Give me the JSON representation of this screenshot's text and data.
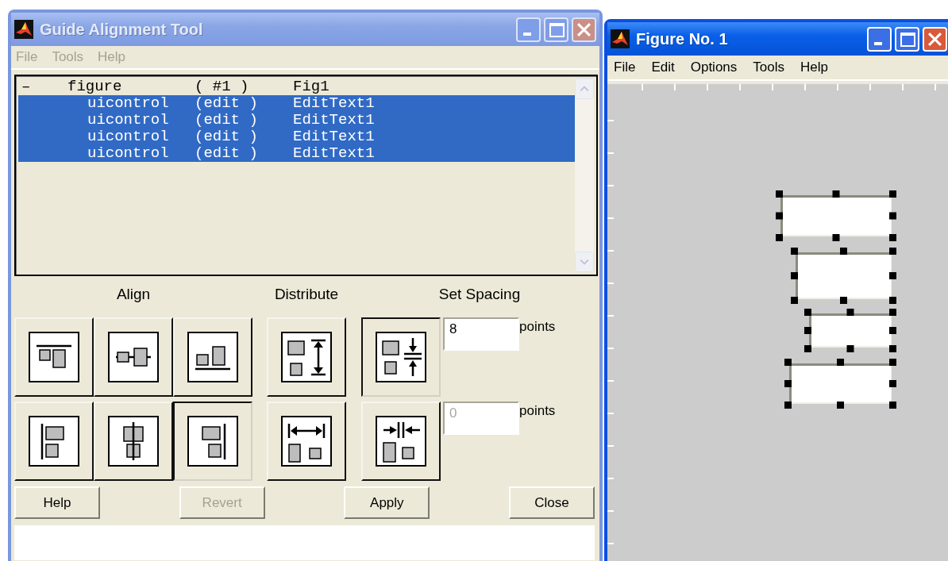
{
  "tool_window": {
    "title": "Guide Alignment Tool",
    "active": false,
    "menu": [
      {
        "label": "File",
        "disabled": true
      },
      {
        "label": "Tools",
        "disabled": true
      },
      {
        "label": "Help",
        "disabled": true
      }
    ],
    "object_list": {
      "rows": [
        {
          "toggle": "–",
          "type": "figure",
          "tag": "( #1 )",
          "name": "Fig1",
          "selected": false,
          "children": [
            {
              "type": "uicontrol",
              "tag": "(edit )",
              "name": "EditText1",
              "selected": true
            },
            {
              "type": "uicontrol",
              "tag": "(edit )",
              "name": "EditText1",
              "selected": true
            },
            {
              "type": "uicontrol",
              "tag": "(edit )",
              "name": "EditText1",
              "selected": true
            },
            {
              "type": "uicontrol",
              "tag": "(edit )",
              "name": "EditText1",
              "selected": true
            }
          ]
        }
      ]
    },
    "align": {
      "heading": "Align",
      "buttons": [
        {
          "kind": "top",
          "pressed": false
        },
        {
          "kind": "vcenter",
          "pressed": false
        },
        {
          "kind": "bottom",
          "pressed": false
        },
        {
          "kind": "left",
          "pressed": false
        },
        {
          "kind": "hcenter",
          "pressed": false
        },
        {
          "kind": "right",
          "pressed": true
        }
      ]
    },
    "distribute": {
      "heading": "Distribute",
      "buttons": [
        {
          "kind": "dist-vertical",
          "pressed": false
        },
        {
          "kind": "dist-horizontal",
          "pressed": false
        }
      ]
    },
    "spacing": {
      "heading": "Set Spacing",
      "rows": [
        {
          "kind": "space-vertical",
          "pressed": true,
          "value": "8",
          "disabled": false,
          "unit": "points"
        },
        {
          "kind": "space-horizontal",
          "pressed": false,
          "value": "0",
          "disabled": true,
          "unit": "points"
        }
      ]
    },
    "buttons": [
      {
        "label": "Help",
        "disabled": false
      },
      {
        "label": "Revert",
        "disabled": true
      },
      {
        "label": "Apply",
        "disabled": false
      },
      {
        "label": "Close",
        "disabled": false
      }
    ]
  },
  "figure_window": {
    "title": "Figure No. 1",
    "active": true,
    "menu": [
      {
        "label": "File",
        "disabled": false
      },
      {
        "label": "Edit",
        "disabled": false
      },
      {
        "label": "Options",
        "disabled": false
      },
      {
        "label": "Tools",
        "disabled": false
      },
      {
        "label": "Help",
        "disabled": false
      }
    ],
    "controls": [
      {
        "selected": true
      },
      {
        "selected": true
      },
      {
        "selected": true
      },
      {
        "selected": true
      }
    ]
  }
}
